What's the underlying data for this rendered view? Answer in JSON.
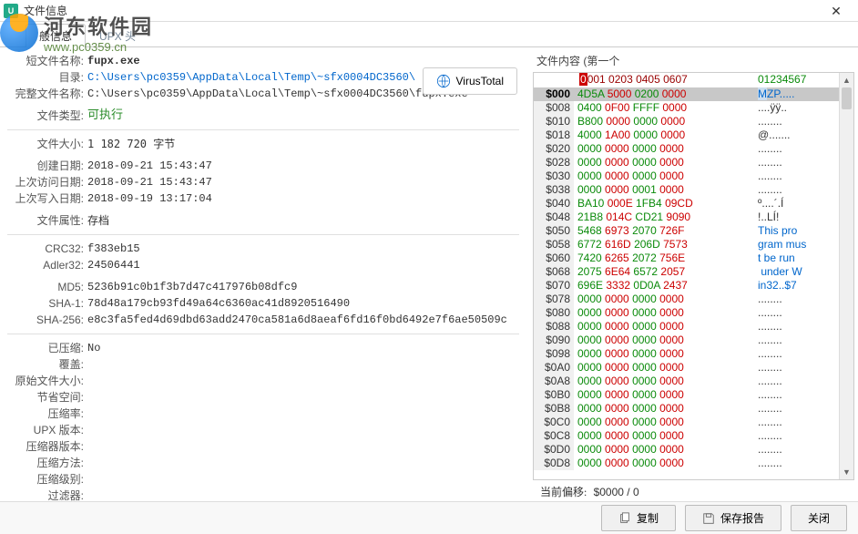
{
  "window": {
    "title": "文件信息"
  },
  "watermark": {
    "cn": "河东软件园",
    "url": "www.pc0359.cn"
  },
  "tabs": [
    {
      "label": "般信息",
      "active": true
    },
    {
      "label": "UPX 头",
      "active": false
    }
  ],
  "info": {
    "short_name_label": "短文件名称:",
    "short_name": "fupx.exe",
    "dir_label": "目录:",
    "dir": "C:\\Users\\pc0359\\AppData\\Local\\Temp\\~sfx0004DC3560\\",
    "full_name_label": "完整文件名称:",
    "full_name": "C:\\Users\\pc0359\\AppData\\Local\\Temp\\~sfx0004DC3560\\fupx.exe",
    "type_label": "文件类型:",
    "type": "可执行",
    "size_label": "文件大小:",
    "size": "1 182 720 字节",
    "created_label": "创建日期:",
    "created": "2018-09-21 15:43:47",
    "accessed_label": "上次访问日期:",
    "accessed": "2018-09-21 15:43:47",
    "modified_label": "上次写入日期:",
    "modified": "2018-09-19 13:17:04",
    "attr_label": "文件属性:",
    "attr": "存档",
    "crc32_label": "CRC32:",
    "crc32": "f383eb15",
    "adler32_label": "Adler32:",
    "adler32": "24506441",
    "md5_label": "MD5:",
    "md5": "5236b91c0b1f3b7d47c417976b08dfc9",
    "sha1_label": "SHA-1:",
    "sha1": "78d48a179cb93fd49a64c6360ac41d8920516490",
    "sha256_label": "SHA-256:",
    "sha256": "e8c3fa5fed4d69dbd63add2470ca581a6d8aeaf6fd16f0bd6492e7f6ae50509c",
    "compressed_label": "已压缩:",
    "compressed": "No",
    "overlay_label": "覆盖:",
    "overlay": "",
    "orig_size_label": "原始文件大小:",
    "orig_size": "",
    "saved_label": "节省空间:",
    "saved": "",
    "ratio_label": "压缩率:",
    "ratio": "",
    "upx_ver_label": "UPX 版本:",
    "upx_ver": "",
    "packer_ver_label": "压缩器版本:",
    "packer_ver": "",
    "method_label": "压缩方法:",
    "method": "",
    "level_label": "压缩级别:",
    "level": "",
    "filter_label": "过滤器:",
    "filter": ""
  },
  "virustotal_label": "VirusTotal",
  "content_title": "文件内容 (第一个",
  "hex_header": {
    "bytes0": "0",
    "bytes_rest": "001 0203 0405 0607",
    "ascii": "01234567"
  },
  "hex_rows": [
    {
      "off": "$000",
      "sel": true,
      "b": [
        [
          "4D5A",
          "g"
        ],
        [
          "5000",
          "r"
        ],
        [
          "0200",
          "g"
        ],
        [
          "0000",
          "r"
        ]
      ],
      "a": "MZP.....",
      "ahl": 1
    },
    {
      "off": "$008",
      "b": [
        [
          "0400",
          "g"
        ],
        [
          "0F00",
          "r"
        ],
        [
          "FFFF",
          "g"
        ],
        [
          "0000",
          "r"
        ]
      ],
      "a": "....ÿÿ.."
    },
    {
      "off": "$010",
      "b": [
        [
          "B800",
          "g"
        ],
        [
          "0000",
          "r"
        ],
        [
          "0000",
          "g"
        ],
        [
          "0000",
          "r"
        ]
      ],
      "a": "........"
    },
    {
      "off": "$018",
      "b": [
        [
          "4000",
          "g"
        ],
        [
          "1A00",
          "r"
        ],
        [
          "0000",
          "g"
        ],
        [
          "0000",
          "r"
        ]
      ],
      "a": "@......."
    },
    {
      "off": "$020",
      "b": [
        [
          "0000",
          "g"
        ],
        [
          "0000",
          "r"
        ],
        [
          "0000",
          "g"
        ],
        [
          "0000",
          "r"
        ]
      ],
      "a": "........"
    },
    {
      "off": "$028",
      "b": [
        [
          "0000",
          "g"
        ],
        [
          "0000",
          "r"
        ],
        [
          "0000",
          "g"
        ],
        [
          "0000",
          "r"
        ]
      ],
      "a": "........"
    },
    {
      "off": "$030",
      "b": [
        [
          "0000",
          "g"
        ],
        [
          "0000",
          "r"
        ],
        [
          "0000",
          "g"
        ],
        [
          "0000",
          "r"
        ]
      ],
      "a": "........"
    },
    {
      "off": "$038",
      "b": [
        [
          "0000",
          "g"
        ],
        [
          "0000",
          "r"
        ],
        [
          "0001",
          "g"
        ],
        [
          "0000",
          "r"
        ]
      ],
      "a": "........"
    },
    {
      "off": "$040",
      "b": [
        [
          "BA10",
          "g"
        ],
        [
          "000E",
          "r"
        ],
        [
          "1FB4",
          "g"
        ],
        [
          "09CD",
          "r"
        ]
      ],
      "a": "º....´.Í"
    },
    {
      "off": "$048",
      "b": [
        [
          "21B8",
          "g"
        ],
        [
          "014C",
          "r"
        ],
        [
          "CD21",
          "g"
        ],
        [
          "9090",
          "r"
        ]
      ],
      "a": "!..LÍ!"
    },
    {
      "off": "$050",
      "b": [
        [
          "5468",
          "g"
        ],
        [
          "6973",
          "r"
        ],
        [
          "2070",
          "g"
        ],
        [
          "726F",
          "r"
        ]
      ],
      "a": "This pro",
      "blue": true
    },
    {
      "off": "$058",
      "b": [
        [
          "6772",
          "g"
        ],
        [
          "616D",
          "r"
        ],
        [
          "206D",
          "g"
        ],
        [
          "7573",
          "r"
        ]
      ],
      "a": "gram mus",
      "blue": true
    },
    {
      "off": "$060",
      "b": [
        [
          "7420",
          "g"
        ],
        [
          "6265",
          "r"
        ],
        [
          "2072",
          "g"
        ],
        [
          "756E",
          "r"
        ]
      ],
      "a": "t be run",
      "blue": true
    },
    {
      "off": "$068",
      "b": [
        [
          "2075",
          "g"
        ],
        [
          "6E64",
          "r"
        ],
        [
          "6572",
          "g"
        ],
        [
          "2057",
          "r"
        ]
      ],
      "a": " under W",
      "blue": true
    },
    {
      "off": "$070",
      "b": [
        [
          "696E",
          "g"
        ],
        [
          "3332",
          "r"
        ],
        [
          "0D0A",
          "g"
        ],
        [
          "2437",
          "r"
        ]
      ],
      "a": "in32..$7",
      "blue": true
    },
    {
      "off": "$078",
      "b": [
        [
          "0000",
          "g"
        ],
        [
          "0000",
          "r"
        ],
        [
          "0000",
          "g"
        ],
        [
          "0000",
          "r"
        ]
      ],
      "a": "........"
    },
    {
      "off": "$080",
      "b": [
        [
          "0000",
          "g"
        ],
        [
          "0000",
          "r"
        ],
        [
          "0000",
          "g"
        ],
        [
          "0000",
          "r"
        ]
      ],
      "a": "........"
    },
    {
      "off": "$088",
      "b": [
        [
          "0000",
          "g"
        ],
        [
          "0000",
          "r"
        ],
        [
          "0000",
          "g"
        ],
        [
          "0000",
          "r"
        ]
      ],
      "a": "........"
    },
    {
      "off": "$090",
      "b": [
        [
          "0000",
          "g"
        ],
        [
          "0000",
          "r"
        ],
        [
          "0000",
          "g"
        ],
        [
          "0000",
          "r"
        ]
      ],
      "a": "........"
    },
    {
      "off": "$098",
      "b": [
        [
          "0000",
          "g"
        ],
        [
          "0000",
          "r"
        ],
        [
          "0000",
          "g"
        ],
        [
          "0000",
          "r"
        ]
      ],
      "a": "........"
    },
    {
      "off": "$0A0",
      "b": [
        [
          "0000",
          "g"
        ],
        [
          "0000",
          "r"
        ],
        [
          "0000",
          "g"
        ],
        [
          "0000",
          "r"
        ]
      ],
      "a": "........"
    },
    {
      "off": "$0A8",
      "b": [
        [
          "0000",
          "g"
        ],
        [
          "0000",
          "r"
        ],
        [
          "0000",
          "g"
        ],
        [
          "0000",
          "r"
        ]
      ],
      "a": "........"
    },
    {
      "off": "$0B0",
      "b": [
        [
          "0000",
          "g"
        ],
        [
          "0000",
          "r"
        ],
        [
          "0000",
          "g"
        ],
        [
          "0000",
          "r"
        ]
      ],
      "a": "........"
    },
    {
      "off": "$0B8",
      "b": [
        [
          "0000",
          "g"
        ],
        [
          "0000",
          "r"
        ],
        [
          "0000",
          "g"
        ],
        [
          "0000",
          "r"
        ]
      ],
      "a": "........"
    },
    {
      "off": "$0C0",
      "b": [
        [
          "0000",
          "g"
        ],
        [
          "0000",
          "r"
        ],
        [
          "0000",
          "g"
        ],
        [
          "0000",
          "r"
        ]
      ],
      "a": "........"
    },
    {
      "off": "$0C8",
      "b": [
        [
          "0000",
          "g"
        ],
        [
          "0000",
          "r"
        ],
        [
          "0000",
          "g"
        ],
        [
          "0000",
          "r"
        ]
      ],
      "a": "........"
    },
    {
      "off": "$0D0",
      "b": [
        [
          "0000",
          "g"
        ],
        [
          "0000",
          "r"
        ],
        [
          "0000",
          "g"
        ],
        [
          "0000",
          "r"
        ]
      ],
      "a": "........"
    },
    {
      "off": "$0D8",
      "b": [
        [
          "0000",
          "g"
        ],
        [
          "0000",
          "r"
        ],
        [
          "0000",
          "g"
        ],
        [
          "0000",
          "r"
        ]
      ],
      "a": "........"
    }
  ],
  "offset_bar": {
    "label": "当前偏移:",
    "value": "$0000  /  0"
  },
  "footer": {
    "copy": "复制",
    "save": "保存报告",
    "close": "关闭"
  }
}
